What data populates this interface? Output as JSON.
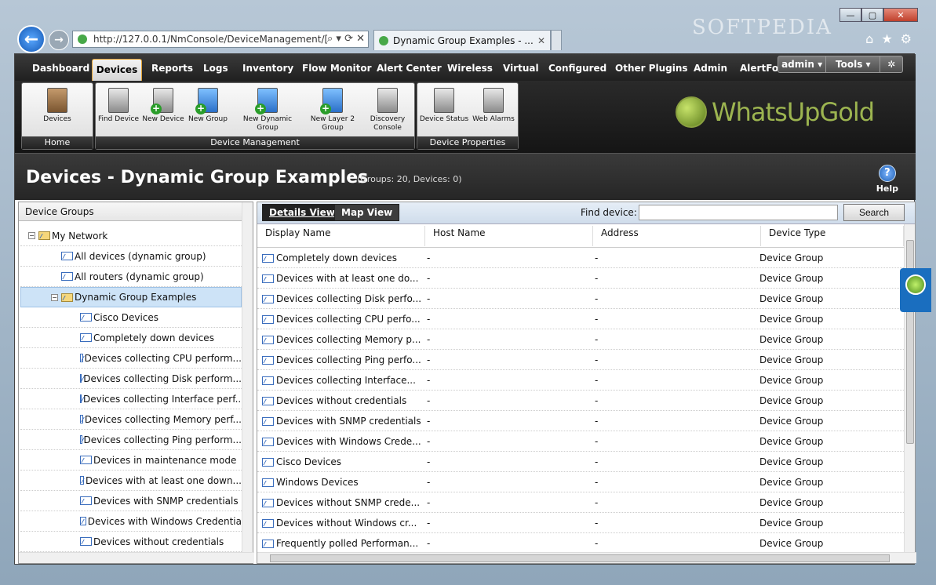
{
  "browser": {
    "url": "http://127.0.0.1/NmConsole/DeviceManagement/[",
    "tab_title": "Dynamic Group Examples - ...",
    "watermark": "SOFTPEDIA"
  },
  "menu": {
    "items": [
      "Dashboard",
      "Devices",
      "Reports",
      "Logs",
      "Inventory",
      "Flow Monitor",
      "Alert Center",
      "Wireless",
      "Virtual",
      "Configured",
      "Other Plugins",
      "Admin",
      "AlertFox"
    ],
    "user": "admin",
    "tools": "Tools"
  },
  "ribbon": {
    "groups": [
      {
        "title": "Home",
        "buttons": [
          "Devices"
        ]
      },
      {
        "title": "Device Management",
        "buttons": [
          "Find Device",
          "New Device",
          "New Group",
          "New Dynamic Group",
          "New Layer 2 Group",
          "Discovery Console"
        ]
      },
      {
        "title": "Device Properties",
        "buttons": [
          "Device Status",
          "Web Alarms"
        ]
      }
    ],
    "logo": "WhatsUpGold"
  },
  "page": {
    "title": "Devices - Dynamic Group Examples",
    "subtitle": "(Groups: 20, Devices: 0)",
    "help": "Help"
  },
  "left": {
    "header": "Device Groups",
    "tree": [
      "My Network",
      "All devices (dynamic group)",
      "All routers (dynamic group)",
      "Dynamic Group Examples",
      "Cisco Devices",
      "Completely down devices",
      "Devices collecting CPU perform...",
      "Devices collecting Disk perform...",
      "Devices collecting Interface perf...",
      "Devices collecting Memory perf...",
      "Devices collecting Ping perform...",
      "Devices in maintenance mode",
      "Devices with at least one down...",
      "Devices with SNMP credentials",
      "Devices with Windows Credentia",
      "Devices without credentials"
    ]
  },
  "right": {
    "tabs": [
      "Details View",
      "Map View"
    ],
    "find_label": "Find device:",
    "search": "Search",
    "columns": [
      "Display Name",
      "Host Name",
      "Address",
      "Device Type"
    ],
    "rows": [
      [
        "Completely down devices",
        "-",
        "-",
        "Device Group"
      ],
      [
        "Devices with at least one do...",
        "-",
        "-",
        "Device Group"
      ],
      [
        "Devices collecting Disk perfo...",
        "-",
        "-",
        "Device Group"
      ],
      [
        "Devices collecting CPU perfo...",
        "-",
        "-",
        "Device Group"
      ],
      [
        "Devices collecting Memory p...",
        "-",
        "-",
        "Device Group"
      ],
      [
        "Devices collecting Ping perfo...",
        "-",
        "-",
        "Device Group"
      ],
      [
        "Devices collecting Interface...",
        "-",
        "-",
        "Device Group"
      ],
      [
        "Devices without credentials",
        "-",
        "-",
        "Device Group"
      ],
      [
        "Devices with SNMP credentials",
        "-",
        "-",
        "Device Group"
      ],
      [
        "Devices with Windows Crede...",
        "-",
        "-",
        "Device Group"
      ],
      [
        "Cisco Devices",
        "-",
        "-",
        "Device Group"
      ],
      [
        "Windows Devices",
        "-",
        "-",
        "Device Group"
      ],
      [
        "Devices without SNMP crede...",
        "-",
        "-",
        "Device Group"
      ],
      [
        "Devices without Windows cr...",
        "-",
        "-",
        "Device Group"
      ],
      [
        "Frequently polled Performan...",
        "-",
        "-",
        "Device Group"
      ]
    ]
  }
}
